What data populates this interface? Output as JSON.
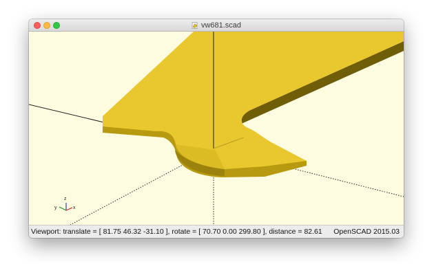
{
  "window": {
    "title": "vw681.scad",
    "title_icon": "scad-document-icon"
  },
  "statusbar": {
    "viewport_info": "Viewport: translate = [ 81.75 46.32 -31.10 ], rotate = [ 70.70 0.00 299.80 ], distance = 82.61",
    "app_version": "OpenSCAD 2015.03"
  },
  "axes_gizmo": {
    "x_label": "x",
    "y_label": "y",
    "z_label": "z"
  },
  "colors": {
    "viewport_background": "#fdfbe0",
    "model_top": "#e8c82e",
    "model_side": "#b89a10",
    "model_side_dark": "#8f7808",
    "close": "#fc605c",
    "minimize": "#fdbc40",
    "maximize": "#34c84a"
  }
}
